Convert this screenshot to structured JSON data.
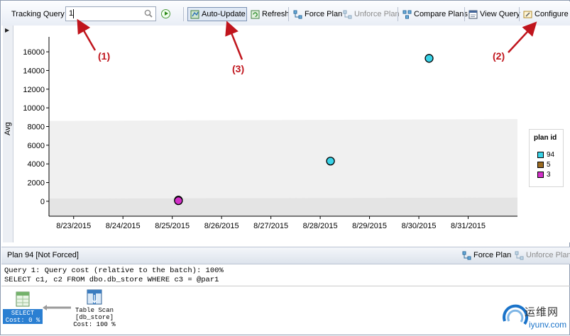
{
  "toolbar": {
    "label": "Tracking Query",
    "search_value": "1",
    "buttons": {
      "auto_update": "Auto-Update",
      "refresh": "Refresh",
      "force_plan": "Force Plan",
      "unforce_plan": "Unforce Plan",
      "compare_plans": "Compare Plans",
      "view_query": "View Query",
      "configure": "Configure"
    }
  },
  "chart_data": {
    "type": "scatter",
    "ylabel": "Avg",
    "xlabel": "",
    "ylim": [
      -1600,
      17600
    ],
    "y_ticks": [
      0,
      2000,
      4000,
      6000,
      8000,
      10000,
      12000,
      14000,
      16000
    ],
    "x_tick_labels": [
      "8/23/2015",
      "8/24/2015",
      "8/25/2015",
      "8/26/2015",
      "8/27/2015",
      "8/28/2015",
      "8/29/2015",
      "8/30/2015",
      "8/31/2015"
    ],
    "xlim": [
      "8/22/2015 12:00",
      "9/1/2015 00:00"
    ],
    "series": [
      {
        "name": "94",
        "color": "#39d3e8",
        "points": [
          {
            "x": "8/28/2015 05:00",
            "y": 4300
          },
          {
            "x": "8/30/2015 05:00",
            "y": 15300
          }
        ]
      },
      {
        "name": "5",
        "color": "#9a6a20",
        "points": [
          {
            "x": "8/25/2015 03:00",
            "y": 120
          }
        ]
      },
      {
        "name": "3",
        "color": "#d230c8",
        "points": [
          {
            "x": "8/25/2015 03:00",
            "y": 60
          }
        ]
      }
    ],
    "legend": {
      "title": "plan id",
      "placement": "right"
    },
    "grid": false
  },
  "plan_bar": {
    "title": "Plan 94 [Not Forced]",
    "force_plan": "Force Plan",
    "unforce_plan": "Unforce Plan"
  },
  "query": {
    "line1": "Query 1: Query cost (relative to the batch): 100%",
    "line2": "SELECT c1, c2 FROM dbo.db_store WHERE c3 = @par1"
  },
  "plan_nodes": {
    "select": {
      "label": "SELECT",
      "cost": "Cost: 0 %"
    },
    "scan": {
      "label": "Table Scan",
      "object": "[db_store]",
      "cost": "Cost: 100 %"
    }
  },
  "annotations": [
    "(1)",
    "(2)",
    "(3)"
  ],
  "watermark": {
    "cn": "运维网",
    "en": "iyunv.com"
  }
}
